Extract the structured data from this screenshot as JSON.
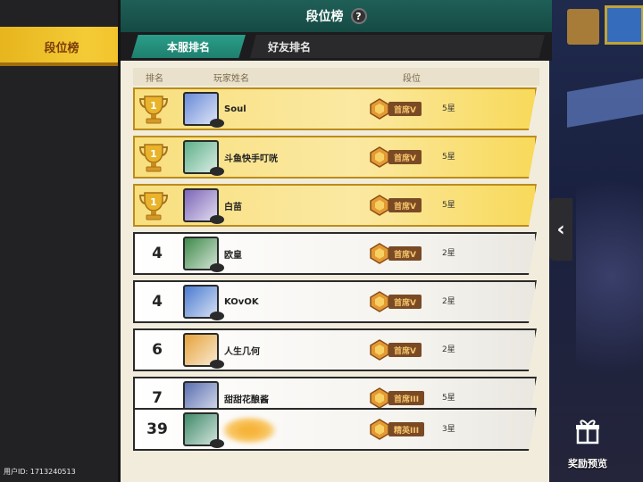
{
  "left": {
    "tab_label": "段位榜",
    "uid": "用户ID: 1713240513"
  },
  "header": {
    "title": "段位榜",
    "help": "?"
  },
  "tabs": [
    {
      "label": "本服排名",
      "active": true
    },
    {
      "label": "好友排名",
      "active": false
    }
  ],
  "columns": {
    "rank": "排名",
    "player": "玩家姓名",
    "tier": "段位"
  },
  "rows": [
    {
      "rank": "1",
      "trophy": true,
      "name": "Soul",
      "tier": "首席V",
      "stars": "5星",
      "avatar_color": "#6a8bd8"
    },
    {
      "rank": "1",
      "trophy": true,
      "name": "斗鱼快手叮咣",
      "tier": "首席V",
      "stars": "5星",
      "avatar_color": "#5fb08a"
    },
    {
      "rank": "1",
      "trophy": true,
      "name": "白苗",
      "tier": "首席V",
      "stars": "5星",
      "avatar_color": "#7d66b8"
    },
    {
      "rank": "4",
      "trophy": false,
      "name": "欧皇",
      "tier": "首席V",
      "stars": "2星",
      "avatar_color": "#3f8a4a"
    },
    {
      "rank": "4",
      "trophy": false,
      "name": "KOvOK",
      "tier": "首席V",
      "stars": "2星",
      "avatar_color": "#4b7bd0"
    },
    {
      "rank": "6",
      "trophy": false,
      "name": "人生几何",
      "tier": "首席V",
      "stars": "2星",
      "avatar_color": "#e6a23a"
    },
    {
      "rank": "7",
      "trophy": false,
      "name": "甜甜花酿酱",
      "tier": "首席III",
      "stars": "5星",
      "avatar_color": "#5a6fb0"
    },
    {
      "rank": "39",
      "trophy": false,
      "name": "",
      "tier": "精英III",
      "stars": "3星",
      "avatar_color": "#3f8a6a"
    }
  ],
  "right": {
    "reward_label": "奖励预览",
    "back_icon": "chevron-left-icon",
    "gift_icon": "gift-icon"
  },
  "colors": {
    "gold_row": "#f8df7e",
    "teal_header": "#1f5f57",
    "tab_active": "#2a9e8a",
    "tier_bg": "#7a4a25"
  }
}
